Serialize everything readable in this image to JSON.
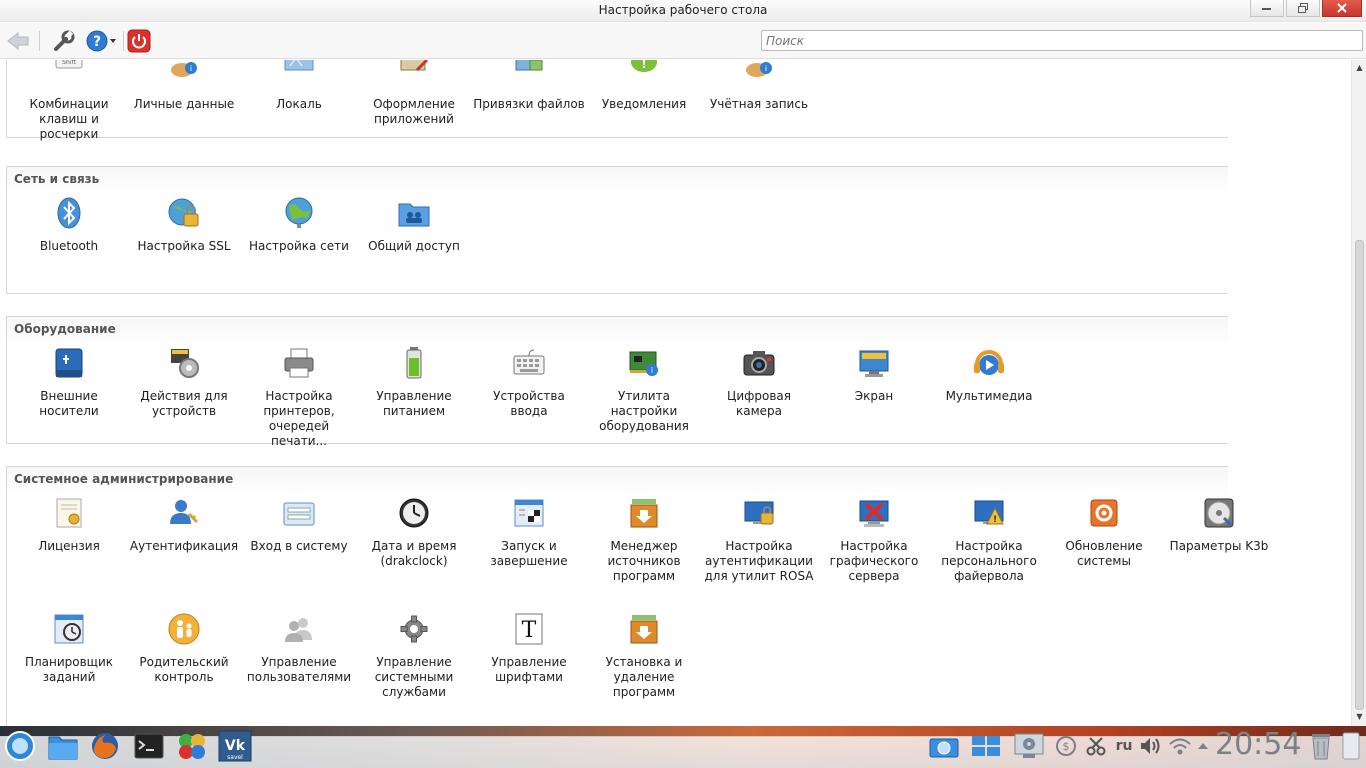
{
  "window": {
    "title": "Настройка рабочего стола",
    "buttons": [
      "minimize",
      "restore",
      "close"
    ]
  },
  "toolbar": {
    "search_placeholder": "Поиск"
  },
  "sections": {
    "personal": {
      "items": [
        {
          "label": "Комбинации клавиш и росчерки",
          "icon": "keyboard-shortcuts-icon"
        },
        {
          "label": "Личные данные",
          "icon": "personal-info-icon"
        },
        {
          "label": "Локаль",
          "icon": "locale-icon"
        },
        {
          "label": "Оформление приложений",
          "icon": "app-appearance-icon"
        },
        {
          "label": "Привязки файлов",
          "icon": "file-associations-icon"
        },
        {
          "label": "Уведомления",
          "icon": "notifications-icon"
        },
        {
          "label": "Учётная запись",
          "icon": "account-icon"
        }
      ]
    },
    "network": {
      "title": "Сеть и связь",
      "items": [
        {
          "label": "Bluetooth",
          "icon": "bluetooth-icon"
        },
        {
          "label": "Настройка SSL",
          "icon": "ssl-icon"
        },
        {
          "label": "Настройка сети",
          "icon": "network-globe-icon"
        },
        {
          "label": "Общий доступ",
          "icon": "shared-folder-icon"
        }
      ]
    },
    "hardware": {
      "title": "Оборудование",
      "items": [
        {
          "label": "Внешние носители",
          "icon": "removable-media-icon"
        },
        {
          "label": "Действия для устройств",
          "icon": "device-actions-icon"
        },
        {
          "label": "Настройка принтеров, очередей печати...",
          "icon": "printer-icon"
        },
        {
          "label": "Управление питанием",
          "icon": "battery-icon"
        },
        {
          "label": "Устройства ввода",
          "icon": "keyboard-icon"
        },
        {
          "label": "Утилита настройки оборудования",
          "icon": "hardware-card-icon"
        },
        {
          "label": "Цифровая камера",
          "icon": "camera-icon"
        },
        {
          "label": "Экран",
          "icon": "display-icon"
        },
        {
          "label": "Мультимедиа",
          "icon": "multimedia-icon"
        }
      ]
    },
    "sysadmin": {
      "title": "Системное администрирование",
      "items": [
        {
          "label": "Лицензия",
          "icon": "license-icon"
        },
        {
          "label": "Аутентификация",
          "icon": "authentication-icon"
        },
        {
          "label": "Вход в систему",
          "icon": "login-icon"
        },
        {
          "label": "Дата и время (drakclock)",
          "icon": "clock-icon"
        },
        {
          "label": "Запуск и завершение",
          "icon": "startup-shutdown-icon"
        },
        {
          "label": "Менеджер источников программ",
          "icon": "software-sources-icon"
        },
        {
          "label": "Настройка аутентификации для утилит ROSA",
          "icon": "rosa-auth-icon"
        },
        {
          "label": "Настройка графического сервера",
          "icon": "graphics-server-icon"
        },
        {
          "label": "Настройка персонального файервола",
          "icon": "firewall-icon"
        },
        {
          "label": "Обновление системы",
          "icon": "system-update-icon"
        },
        {
          "label": "Параметры K3b",
          "icon": "k3b-icon"
        },
        {
          "label": "Планировщик заданий",
          "icon": "task-scheduler-icon"
        },
        {
          "label": "Родительский контроль",
          "icon": "parental-control-icon"
        },
        {
          "label": "Управление пользователями",
          "icon": "users-icon"
        },
        {
          "label": "Управление системными службами",
          "icon": "services-gear-icon"
        },
        {
          "label": "Управление шрифтами",
          "icon": "fonts-icon"
        },
        {
          "label": "Установка и удаление программ",
          "icon": "install-remove-icon"
        }
      ]
    }
  },
  "taskbar": {
    "tray": {
      "language": "ru",
      "clock": "20:54"
    },
    "vk_badge": "savel"
  },
  "colors": {
    "accent_blue": "#2e7cd6",
    "close_red": "#c7362b",
    "power_red": "#d8322a"
  }
}
